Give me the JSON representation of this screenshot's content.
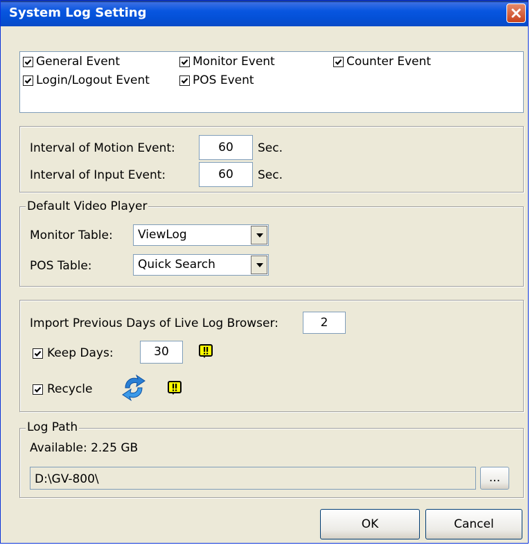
{
  "window": {
    "title": "System Log Setting"
  },
  "events": {
    "items": [
      {
        "label": "General Event",
        "checked": true
      },
      {
        "label": "Monitor Event",
        "checked": true
      },
      {
        "label": "Counter Event",
        "checked": true
      },
      {
        "label": "Login/Logout Event",
        "checked": true
      },
      {
        "label": "POS Event",
        "checked": true
      }
    ]
  },
  "intervals": {
    "motion": {
      "label": "Interval of Motion Event:",
      "value": "60",
      "unit": "Sec."
    },
    "input": {
      "label": "Interval of Input Event:",
      "value": "60",
      "unit": "Sec."
    }
  },
  "video_player": {
    "legend": "Default Video Player",
    "monitor": {
      "label": "Monitor Table:",
      "value": "ViewLog"
    },
    "pos": {
      "label": "POS Table:",
      "value": "Quick Search"
    }
  },
  "live_log": {
    "import_label": "Import Previous Days of Live Log Browser:",
    "import_value": "2",
    "keep_days_label": "Keep Days:",
    "keep_days_checked": true,
    "keep_days_value": "30",
    "recycle_label": "Recycle",
    "recycle_checked": true
  },
  "log_path": {
    "legend": "Log Path",
    "available": "Available: 2.25 GB",
    "path": "D:\\GV-800\\",
    "browse_label": "..."
  },
  "buttons": {
    "ok": "OK",
    "cancel": "Cancel"
  },
  "colors": {
    "titlebar": "#0450d6",
    "close": "#c8421c",
    "dialog": "#ece9d8",
    "warn": "#ffff00"
  },
  "icons": {
    "close": "close-icon",
    "warning": "warning-icon",
    "recycle": "recycle-icon",
    "dropdown": "chevron-down-icon"
  }
}
